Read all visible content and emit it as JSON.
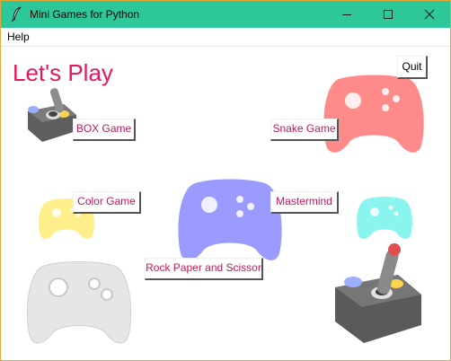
{
  "window": {
    "title": "Mini Games for Python",
    "icon": "feather-icon",
    "controls": [
      "minimize-icon",
      "maximize-icon",
      "close-icon"
    ]
  },
  "menu": {
    "help_label": "Help"
  },
  "main": {
    "heading": "Let's Play",
    "quit_label": "Quit",
    "games": [
      {
        "label": "BOX Game",
        "icon": "joystick-icon"
      },
      {
        "label": "Snake Game",
        "icon": "gamepad-icon"
      },
      {
        "label": "Color Game",
        "icon": "gamepad-icon"
      },
      {
        "label": "Mastermind",
        "icon": "gamepad-icon"
      },
      {
        "label": "Rock Paper and Scissor",
        "icon": "gamepad-icon"
      }
    ]
  },
  "colors": {
    "titlebar": "#2ec79a",
    "heading": "#e8155f",
    "button_text": "#c2185b",
    "pad_red": "#ff8a8a",
    "pad_blue": "#9a9aff",
    "pad_yellow": "#ffef8a",
    "pad_cyan": "#8af5ee",
    "pad_white": "#e6e6e6",
    "joystick_gray": "#6e6e6e"
  }
}
